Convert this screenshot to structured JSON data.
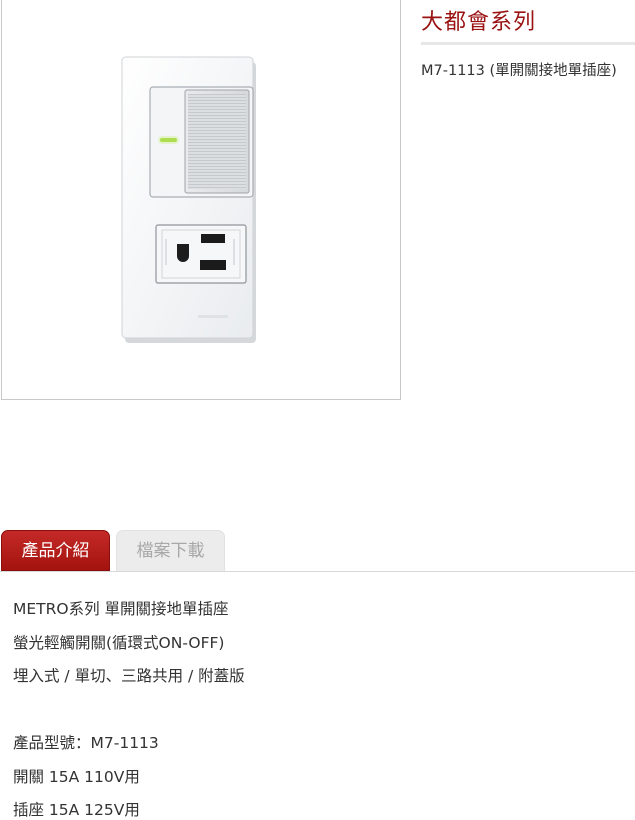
{
  "product": {
    "series_title": "大都會系列",
    "model_line": "M7-1113 (單開關接地單插座)",
    "image_alt": "product-photo-switch-outlet"
  },
  "tabs": [
    {
      "label": "產品介紹",
      "active": true
    },
    {
      "label": "檔案下載",
      "active": false
    }
  ],
  "description": {
    "lines": [
      "METRO系列 單開關接地單插座",
      "螢光輕觸開關(循環式ON-OFF)",
      "埋入式 / 單切、三路共用 / 附蓋版"
    ],
    "specs": [
      "產品型號：M7-1113",
      "開關 15A 110V用",
      "插座 15A 125V用"
    ]
  },
  "colors": {
    "accent": "#9a1212",
    "tab_active": "#b31b18",
    "tab_inactive": "#ececec",
    "indicator": "#9fd43a"
  }
}
